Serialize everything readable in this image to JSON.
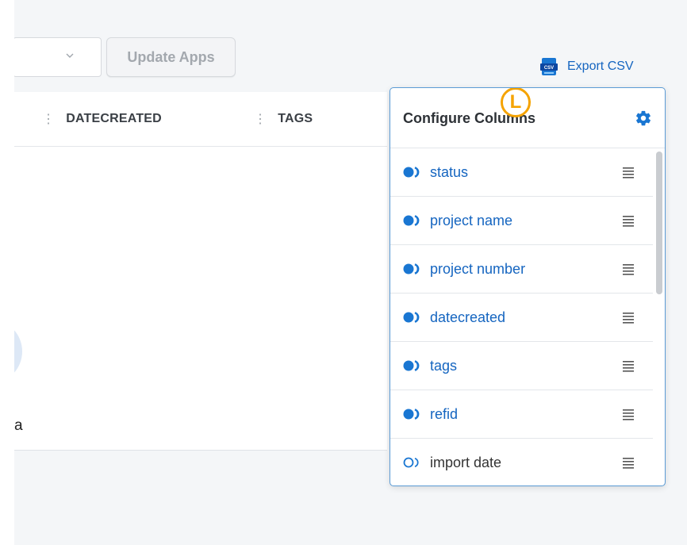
{
  "toolbar": {
    "select_value": "",
    "update_label": "Update Apps",
    "export_label": "Export CSV",
    "export_icon": "csv-file-icon"
  },
  "table": {
    "columns": [
      "DATECREATED",
      "TAGS"
    ],
    "empty_text": "a"
  },
  "config_popup": {
    "title": "Configure Columns",
    "settings_icon": "gear-icon",
    "marker_letter": "L",
    "columns": [
      {
        "label": "status",
        "enabled": true
      },
      {
        "label": "project name",
        "enabled": true
      },
      {
        "label": "project number",
        "enabled": true
      },
      {
        "label": "datecreated",
        "enabled": true
      },
      {
        "label": "tags",
        "enabled": true
      },
      {
        "label": "refid",
        "enabled": true
      },
      {
        "label": "import date",
        "enabled": false
      }
    ]
  },
  "colors": {
    "accent": "#1565c0",
    "marker": "#f5a300",
    "popup_border": "#5b9bd5"
  }
}
